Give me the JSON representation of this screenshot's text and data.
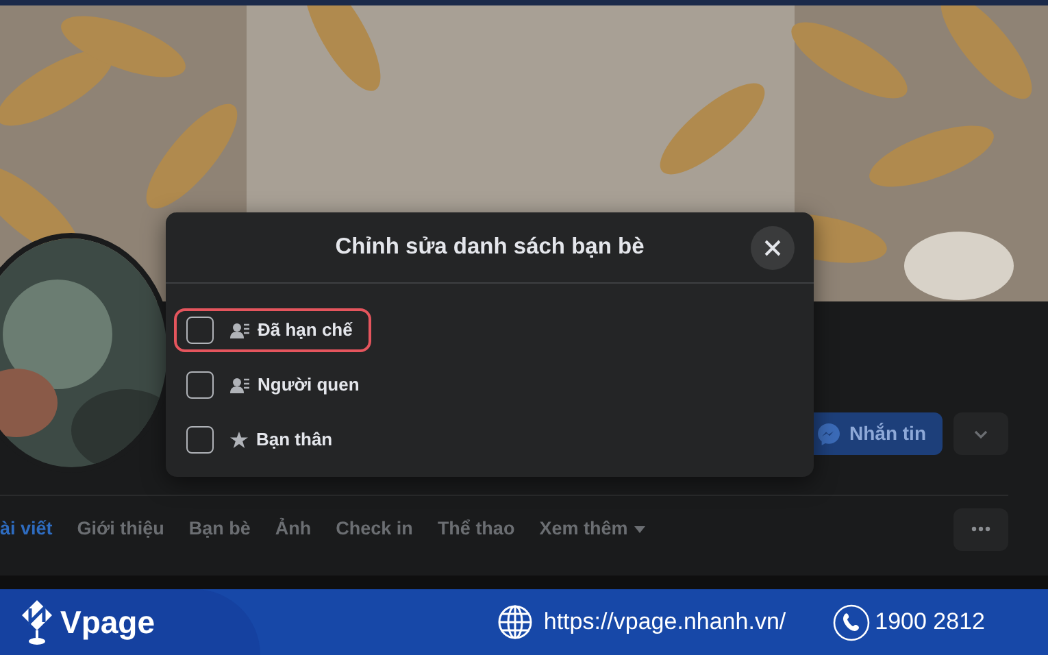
{
  "profile": {
    "actions": [
      {
        "kind": "message",
        "label": "Nhắn tin"
      },
      {
        "kind": "more"
      }
    ]
  },
  "tabs": [
    {
      "label": "ài viết",
      "selected": true,
      "dropdown": false
    },
    {
      "label": "Giới thiệu",
      "selected": false,
      "dropdown": false
    },
    {
      "label": "Bạn bè",
      "selected": false,
      "dropdown": false
    },
    {
      "label": "Ảnh",
      "selected": false,
      "dropdown": false
    },
    {
      "label": "Check in",
      "selected": false,
      "dropdown": false
    },
    {
      "label": "Thể thao",
      "selected": false,
      "dropdown": false
    },
    {
      "label": "Xem thêm",
      "selected": false,
      "dropdown": true
    }
  ],
  "dialog": {
    "title": "Chỉnh sửa danh sách bạn bè",
    "items": [
      {
        "label": "Đã hạn chế",
        "kind": "list",
        "checked": false,
        "highlighted": true
      },
      {
        "label": "Người quen",
        "kind": "list",
        "checked": false,
        "highlighted": false
      },
      {
        "label": "Bạn thân",
        "kind": "star",
        "checked": false,
        "highlighted": false
      }
    ]
  },
  "banner": {
    "brand": "Vpage",
    "website": "https://vpage.nhanh.vn/",
    "phone": "1900 2812"
  }
}
